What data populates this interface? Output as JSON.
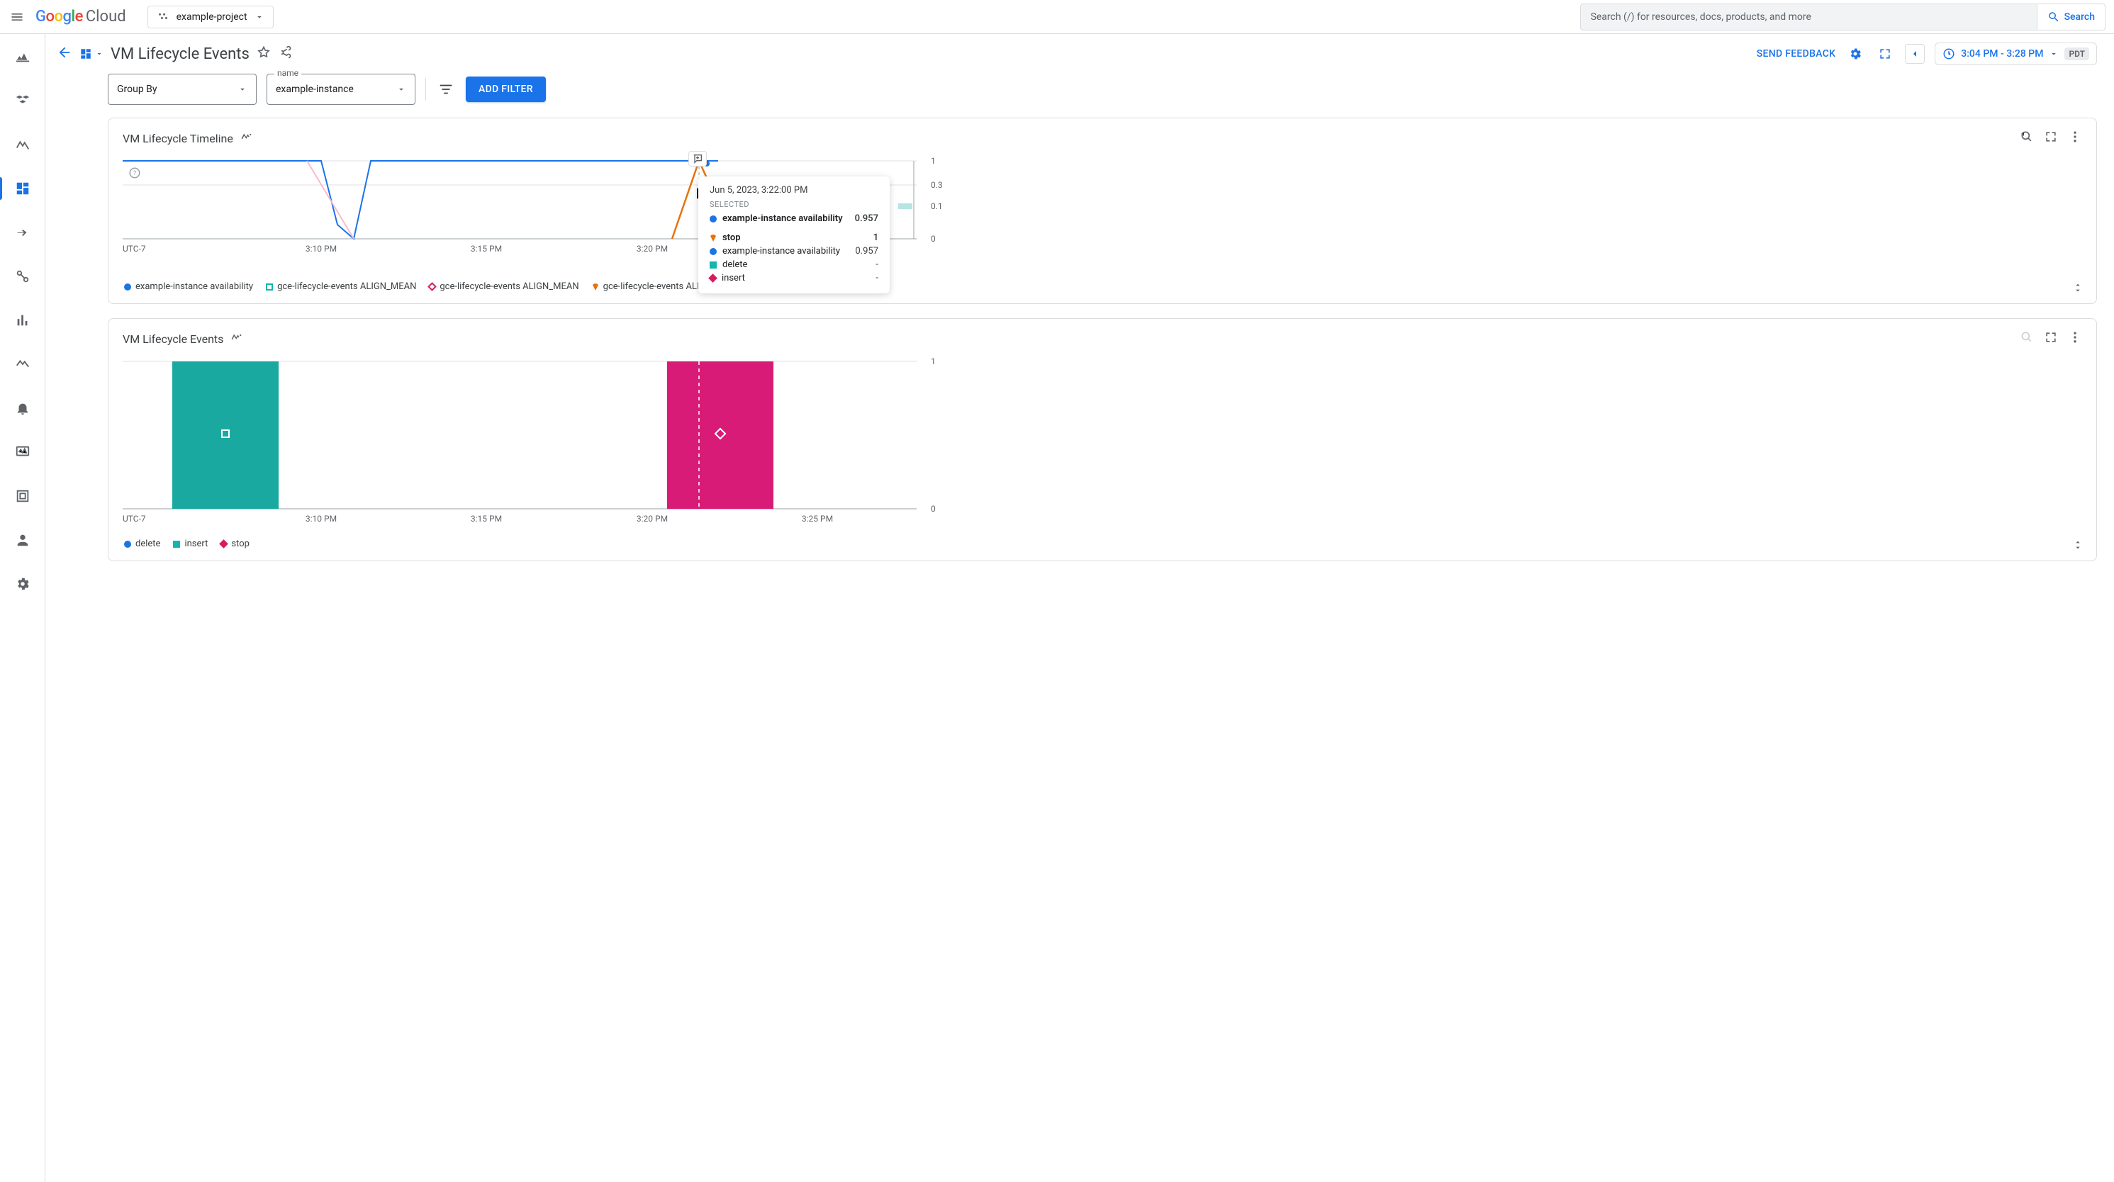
{
  "top": {
    "product_label": "Cloud",
    "project_name": "example-project",
    "search_placeholder": "Search (/) for resources, docs, products, and more",
    "search_button": "Search"
  },
  "page": {
    "title": "VM Lifecycle Events",
    "feedback": "SEND FEEDBACK",
    "time_range": "3:04 PM - 3:28 PM",
    "tz": "PDT"
  },
  "filters": {
    "groupby_label": "Group By",
    "name_float": "name",
    "name_value": "example-instance",
    "add_filter": "ADD FILTER"
  },
  "timeline": {
    "title": "VM Lifecycle Timeline",
    "tz_label": "UTC-7",
    "x_ticks": [
      "3:10 PM",
      "3:15 PM",
      "3:20 PM",
      "3:25 PM"
    ],
    "y_ticks": [
      "1",
      "0.3",
      "0.1",
      "0"
    ],
    "legend": [
      {
        "label": "example-instance availability",
        "marker": "circle",
        "color": "#1a73e8"
      },
      {
        "label": "gce-lifecycle-events ALIGN_MEAN",
        "marker": "square-open",
        "color": "#12b5b0"
      },
      {
        "label": "gce-lifecycle-events ALIGN_MEAN",
        "marker": "diamond-open",
        "color": "#d81b60"
      },
      {
        "label": "gce-lifecycle-events ALIGN_MEAN",
        "marker": "triangle-down",
        "color": "#e8710a"
      }
    ]
  },
  "events": {
    "title": "VM Lifecycle Events",
    "tz_label": "UTC-7",
    "x_ticks": [
      "3:10 PM",
      "3:15 PM",
      "3:20 PM",
      "3:25 PM"
    ],
    "y_ticks": [
      "1",
      "0"
    ],
    "legend": [
      {
        "label": "delete",
        "marker": "circle",
        "color": "#1a73e8"
      },
      {
        "label": "insert",
        "marker": "square",
        "color": "#12b5b0"
      },
      {
        "label": "stop",
        "marker": "diamond",
        "color": "#d81b60"
      }
    ]
  },
  "tooltip": {
    "timestamp": "Jun 5, 2023, 3:22:00 PM",
    "section_selected": "SELECTED",
    "rows": [
      {
        "kind": "selected",
        "swatch": "#1a73e8",
        "shape": "circle",
        "label": "example-instance availability",
        "value": "0.957"
      },
      {
        "swatch": "#e8710a",
        "shape": "triangle-down",
        "label": "stop",
        "value": "1"
      },
      {
        "swatch": "#1a73e8",
        "shape": "circle",
        "label": "example-instance availability",
        "value": "0.957"
      },
      {
        "swatch": "#12b5b0",
        "shape": "square",
        "label": "delete",
        "value": "-"
      },
      {
        "swatch": "#d81b60",
        "shape": "diamond",
        "label": "insert",
        "value": "-"
      }
    ]
  },
  "chart_data": [
    {
      "type": "line",
      "title": "VM Lifecycle Timeline",
      "xlabel": "UTC-7",
      "ylabel": "",
      "xlim_minutes": [
        184,
        208
      ],
      "ylim": [
        0,
        1
      ],
      "y_ticks": [
        0,
        0.1,
        0.3,
        1
      ],
      "x": [
        184,
        186,
        188,
        190,
        191,
        192,
        194,
        196,
        198,
        200,
        202,
        203,
        204,
        206,
        208
      ],
      "series": [
        {
          "name": "example-instance availability",
          "color": "#1a73e8",
          "values": [
            1,
            1,
            1,
            0.5,
            0,
            1,
            1,
            1,
            1,
            1,
            0.957,
            null,
            null,
            null,
            null
          ]
        },
        {
          "name": "stop (gce-lifecycle-events ALIGN_MEAN)",
          "color": "#e8710a",
          "values": [
            null,
            null,
            null,
            null,
            null,
            null,
            null,
            null,
            null,
            null,
            1,
            null,
            null,
            null,
            null
          ],
          "note": "single peak at 3:22 PM"
        },
        {
          "name": "insert (gce-lifecycle-events ALIGN_MEAN)",
          "color": "#d81b60",
          "values": [
            0,
            0,
            0,
            0,
            0,
            0,
            0,
            0,
            0,
            0,
            0,
            0,
            0,
            0,
            0
          ]
        },
        {
          "name": "delete (gce-lifecycle-events ALIGN_MEAN)",
          "color": "#12b5b0",
          "values": [
            0,
            0,
            0,
            0,
            0,
            0,
            0,
            0,
            0,
            0,
            0,
            0,
            0,
            0,
            0
          ]
        }
      ],
      "highlight_x": 202,
      "hover": {
        "time": "Jun 5, 2023, 3:22:00 PM",
        "availability": 0.957,
        "stop": 1
      }
    },
    {
      "type": "bar",
      "title": "VM Lifecycle Events",
      "xlabel": "UTC-7",
      "ylabel": "",
      "ylim": [
        0,
        1
      ],
      "categories_minutes": [
        187,
        188,
        189,
        190,
        200,
        201,
        202,
        203
      ],
      "series": [
        {
          "name": "delete",
          "color": "#1a73e8",
          "values": [
            0,
            0,
            0,
            0,
            0,
            0,
            0,
            0
          ]
        },
        {
          "name": "insert",
          "color": "#12b5b0",
          "values": [
            1,
            1,
            1,
            1,
            0,
            0,
            0,
            0
          ],
          "note": "block ~3:07–3:10 PM"
        },
        {
          "name": "stop",
          "color": "#d81b60",
          "values": [
            0,
            0,
            0,
            0,
            1,
            1,
            1,
            1
          ],
          "note": "block ~3:20–3:23 PM"
        }
      ],
      "highlight_x": 202
    }
  ]
}
